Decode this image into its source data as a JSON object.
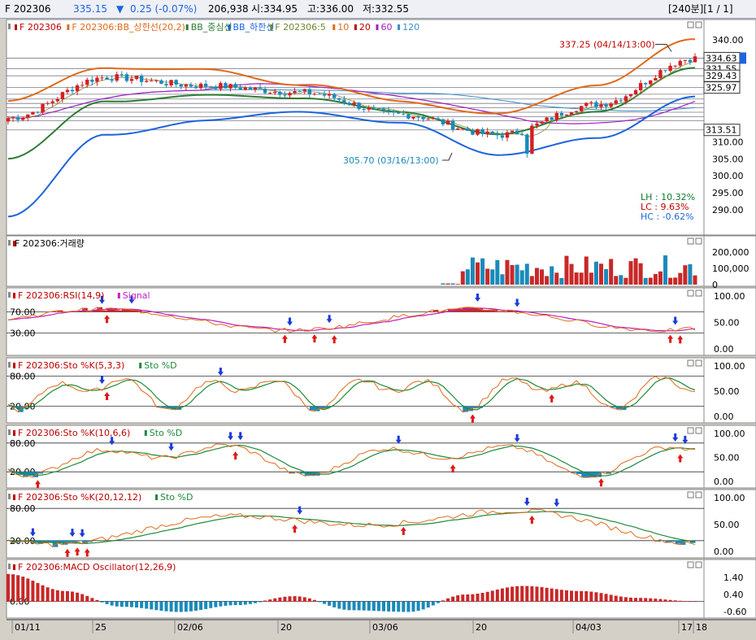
{
  "header": {
    "symbol": "F 202306",
    "price": "335.15",
    "change_arrow": "▼",
    "change": "0.25 (-0.07%)",
    "volume": "206,938",
    "open": "시:334.95",
    "high": "고:336.00",
    "low": "저:332.55",
    "period_page": "[240분][1 / 1]"
  },
  "price_panel": {
    "legend": [
      {
        "text": "F 202306",
        "color": "#c00000"
      },
      {
        "text": "F 202306:BB_상한선(20,2)",
        "color": "#e06a1a"
      },
      {
        "text": "BB_중심선",
        "color": "#2e7d32"
      },
      {
        "text": "BB_하한선",
        "color": "#1e64dc"
      },
      {
        "text": "F 202306:5",
        "color": "#6a8a30"
      },
      {
        "text": "10",
        "color": "#e06a1a"
      },
      {
        "text": "20",
        "color": "#c00000"
      },
      {
        "text": "60",
        "color": "#a020c0"
      },
      {
        "text": "120",
        "color": "#3a8fc8"
      }
    ],
    "high_note": "337.25 (04/14/13:00)",
    "low_note": "305.70 (03/16/13:00)",
    "stats": [
      {
        "text": "LH : 10.32%",
        "color": "#0a7a2a"
      },
      {
        "text": "LC :  9.63%",
        "color": "#c00000"
      },
      {
        "text": "HC : -0.62%",
        "color": "#1e64dc"
      }
    ],
    "axis_ticks": [
      "340.00",
      "310.00",
      "305.00",
      "300.00",
      "295.00",
      "290.00"
    ],
    "price_boxes": [
      "334.63",
      "331.55",
      "329.43",
      "325.97",
      "313.51"
    ]
  },
  "volume_panel": {
    "legend": "F 202306:거래량",
    "axis_ticks": [
      "200,000",
      "100,000",
      "0"
    ]
  },
  "rsi_panel": {
    "legend": "F 202306:RSI(14,9)",
    "legend2": "Signal",
    "axis_ticks": [
      "100.00",
      "50.00",
      "0.00"
    ],
    "levels": [
      "70.00",
      "30.00"
    ]
  },
  "sto1_panel": {
    "legend": "F 202306:Sto %K(5,3,3)",
    "legend2": "Sto %D",
    "axis_ticks": [
      "100.00",
      "50.00",
      "0.00"
    ],
    "levels": [
      "80.00",
      "20.00"
    ]
  },
  "sto2_panel": {
    "legend": "F 202306:Sto %K(10,6,6)",
    "legend2": "Sto %D",
    "axis_ticks": [
      "100.00",
      "50.00",
      "0.00"
    ],
    "levels": [
      "80.00",
      "20.00"
    ]
  },
  "sto3_panel": {
    "legend": "F 202306:Sto %K(20,12,12)",
    "legend2": "Sto %D",
    "axis_ticks": [
      "100.00",
      "50.00",
      "0.00"
    ],
    "levels": [
      "80.00",
      "20.00"
    ]
  },
  "macd_panel": {
    "legend": "F 202306:MACD Oscillator(12,26,9)",
    "axis_ticks": [
      "1.40",
      "0.40",
      "-0.60"
    ],
    "level": "0.00"
  },
  "x_axis": {
    "labels": [
      "01/11",
      "25",
      "02/06",
      "20",
      "03/06",
      "20",
      "04/03",
      "17",
      "18"
    ]
  },
  "chart_data": {
    "type": "candlestick",
    "x": [
      "01/11",
      "25",
      "02/06",
      "20",
      "03/06",
      "20",
      "04/03",
      "17"
    ],
    "close_approx": [
      317.0,
      329.0,
      326.5,
      324.5,
      318.0,
      312.0,
      321.0,
      334.6
    ],
    "bb_upper_approx": [
      322.0,
      332.0,
      331.0,
      327.0,
      322.0,
      318.0,
      327.0,
      340.0
    ],
    "bb_lower_approx": [
      288.0,
      312.0,
      316.5,
      318.5,
      316.0,
      305.7,
      311.5,
      323.0
    ],
    "high": 337.25,
    "low": 305.7,
    "last": 335.15,
    "volume_range": [
      0,
      200000
    ],
    "macd_range": [
      -0.6,
      1.4
    ]
  }
}
